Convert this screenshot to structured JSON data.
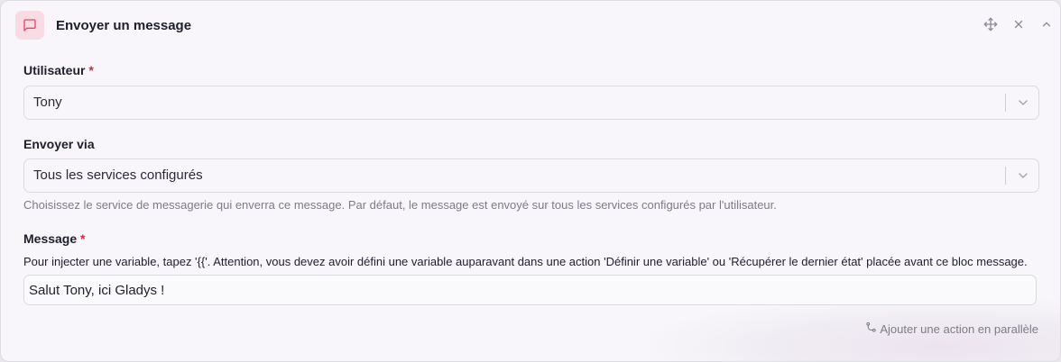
{
  "header": {
    "title": "Envoyer un message",
    "icon": "message-square-icon",
    "accent": "#e8446a"
  },
  "user_field": {
    "label": "Utilisateur",
    "required_mark": "*",
    "value": "Tony"
  },
  "send_via_field": {
    "label": "Envoyer via",
    "value": "Tous les services configurés",
    "help": "Choisissez le service de messagerie qui enverra ce message. Par défaut, le message est envoyé sur tous les services configurés par l'utilisateur."
  },
  "message_field": {
    "label": "Message",
    "required_mark": "*",
    "note": "Pour injecter une variable, tapez '{{'. Attention, vous devez avoir défini une variable auparavant dans une action 'Définir une variable' ou 'Récupérer le dernier état' placée avant ce bloc message.",
    "value": "Salut Tony, ici Gladys !"
  },
  "footer": {
    "parallel_action": "Ajouter une action en parallèle"
  }
}
